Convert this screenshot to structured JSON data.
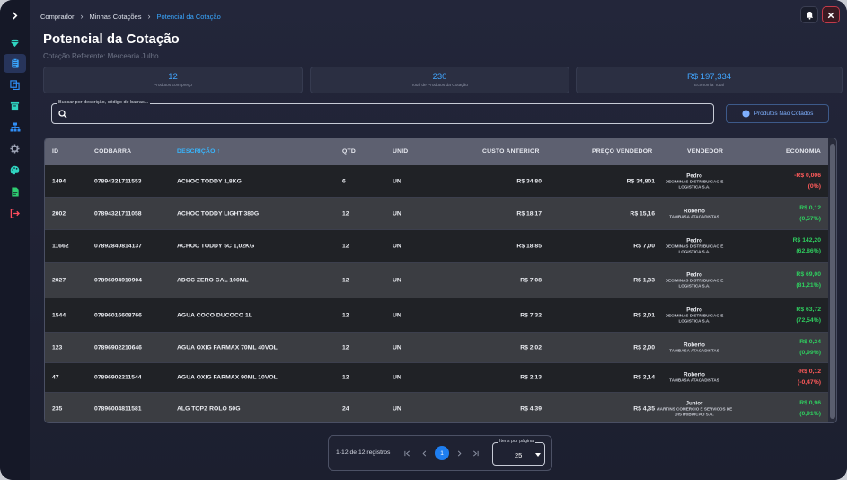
{
  "breadcrumb": [
    "Comprador",
    "Minhas Cotações",
    "Potencial da Cotação"
  ],
  "page_title": "Potencial da Cotação",
  "subtitle": "Cotação Referente: Mercearia Julho",
  "stats": [
    {
      "value": "12",
      "label": "Produtos com preço"
    },
    {
      "value": "230",
      "label": "Total de Produtos da Cotação"
    },
    {
      "value": "R$ 197,334",
      "label": "Economia Total"
    }
  ],
  "search": {
    "label": "Buscar por descrição, código de barras...",
    "value": ""
  },
  "not_quoted_button": "Produtos Não Cotados",
  "columns": {
    "id": "ID",
    "codbarra": "CODBARRA",
    "descricao": "DESCRIÇÃO",
    "qtd": "QTD",
    "unid": "UNID",
    "custo": "CUSTO ANTERIOR",
    "preco": "PREÇO VENDEDOR",
    "vendedor": "VENDEDOR",
    "economia": "ECONOMIA"
  },
  "rows": [
    {
      "id": "1494",
      "cod": "07894321711553",
      "desc": "ACHOC TODDY 1,8KG",
      "qtd": "6",
      "unid": "UN",
      "custo": "R$ 34,80",
      "preco": "R$ 34,801",
      "vend_name": "Pedro",
      "vend_company": "DECIMINAS DISTRIBUICAO E LOGISTICA S.A.",
      "eco_value": "-R$ 0,006",
      "eco_pct": "(0%)",
      "eco_sign": "neg"
    },
    {
      "id": "2002",
      "cod": "07894321711058",
      "desc": "ACHOC TODDY LIGHT 380G",
      "qtd": "12",
      "unid": "UN",
      "custo": "R$ 18,17",
      "preco": "R$ 15,16",
      "vend_name": "Roberto",
      "vend_company": "TAMBASA ATACADISTAS",
      "eco_value": "R$ 0,12",
      "eco_pct": "(0,57%)",
      "eco_sign": "pos"
    },
    {
      "id": "11662",
      "cod": "07892840814137",
      "desc": "ACHOC TODDY 5C 1,02KG",
      "qtd": "12",
      "unid": "UN",
      "custo": "R$ 18,85",
      "preco": "R$ 7,00",
      "vend_name": "Pedro",
      "vend_company": "DECIMINAS DISTRIBUICAO E LOGISTICA S.A.",
      "eco_value": "R$ 142,20",
      "eco_pct": "(62,86%)",
      "eco_sign": "pos"
    },
    {
      "id": "2027",
      "cod": "07896094910904",
      "desc": "ADOC ZERO CAL 100ML",
      "qtd": "12",
      "unid": "UN",
      "custo": "R$ 7,08",
      "preco": "R$ 1,33",
      "vend_name": "Pedro",
      "vend_company": "DECIMINAS DISTRIBUICAO E LOGISTICA S.A.",
      "eco_value": "R$ 69,00",
      "eco_pct": "(81,21%)",
      "eco_sign": "pos"
    },
    {
      "id": "1544",
      "cod": "07896016608766",
      "desc": "AGUA COCO DUCOCO 1L",
      "qtd": "12",
      "unid": "UN",
      "custo": "R$ 7,32",
      "preco": "R$ 2,01",
      "vend_name": "Pedro",
      "vend_company": "DECIMINAS DISTRIBUICAO E LOGISTICA S.A.",
      "eco_value": "R$ 63,72",
      "eco_pct": "(72,54%)",
      "eco_sign": "pos"
    },
    {
      "id": "123",
      "cod": "07896902210646",
      "desc": "AGUA OXIG FARMAX 70ML 40VOL",
      "qtd": "12",
      "unid": "UN",
      "custo": "R$ 2,02",
      "preco": "R$ 2,00",
      "vend_name": "Roberto",
      "vend_company": "TAMBASA ATACADISTAS",
      "eco_value": "R$ 0,24",
      "eco_pct": "(0,99%)",
      "eco_sign": "pos"
    },
    {
      "id": "47",
      "cod": "07896902211544",
      "desc": "AGUA OXIG FARMAX 90ML 10VOL",
      "qtd": "12",
      "unid": "UN",
      "custo": "R$ 2,13",
      "preco": "R$ 2,14",
      "vend_name": "Roberto",
      "vend_company": "TAMBASA ATACADISTAS",
      "eco_value": "-R$ 0,12",
      "eco_pct": "(-0,47%)",
      "eco_sign": "neg"
    },
    {
      "id": "235",
      "cod": "07896004811581",
      "desc": "ALG TOPZ ROLO 50G",
      "qtd": "24",
      "unid": "UN",
      "custo": "R$ 4,39",
      "preco": "R$ 4,35",
      "vend_name": "Junior",
      "vend_company": "MARTINS COMERCIO E SERVICOS DE DISTRIBUICAO S.A.",
      "eco_value": "R$ 0,96",
      "eco_pct": "(0,91%)",
      "eco_sign": "pos"
    }
  ],
  "pagination": {
    "info": "1-12 de 12 registros",
    "current_page": "1",
    "per_page_label": "Itens por página",
    "per_page": "25"
  },
  "colors": {
    "accent": "#3aa7ff",
    "positive": "#2fce5f",
    "negative": "#ff5a5a",
    "sidebar_icon": "#2fd3c0"
  }
}
